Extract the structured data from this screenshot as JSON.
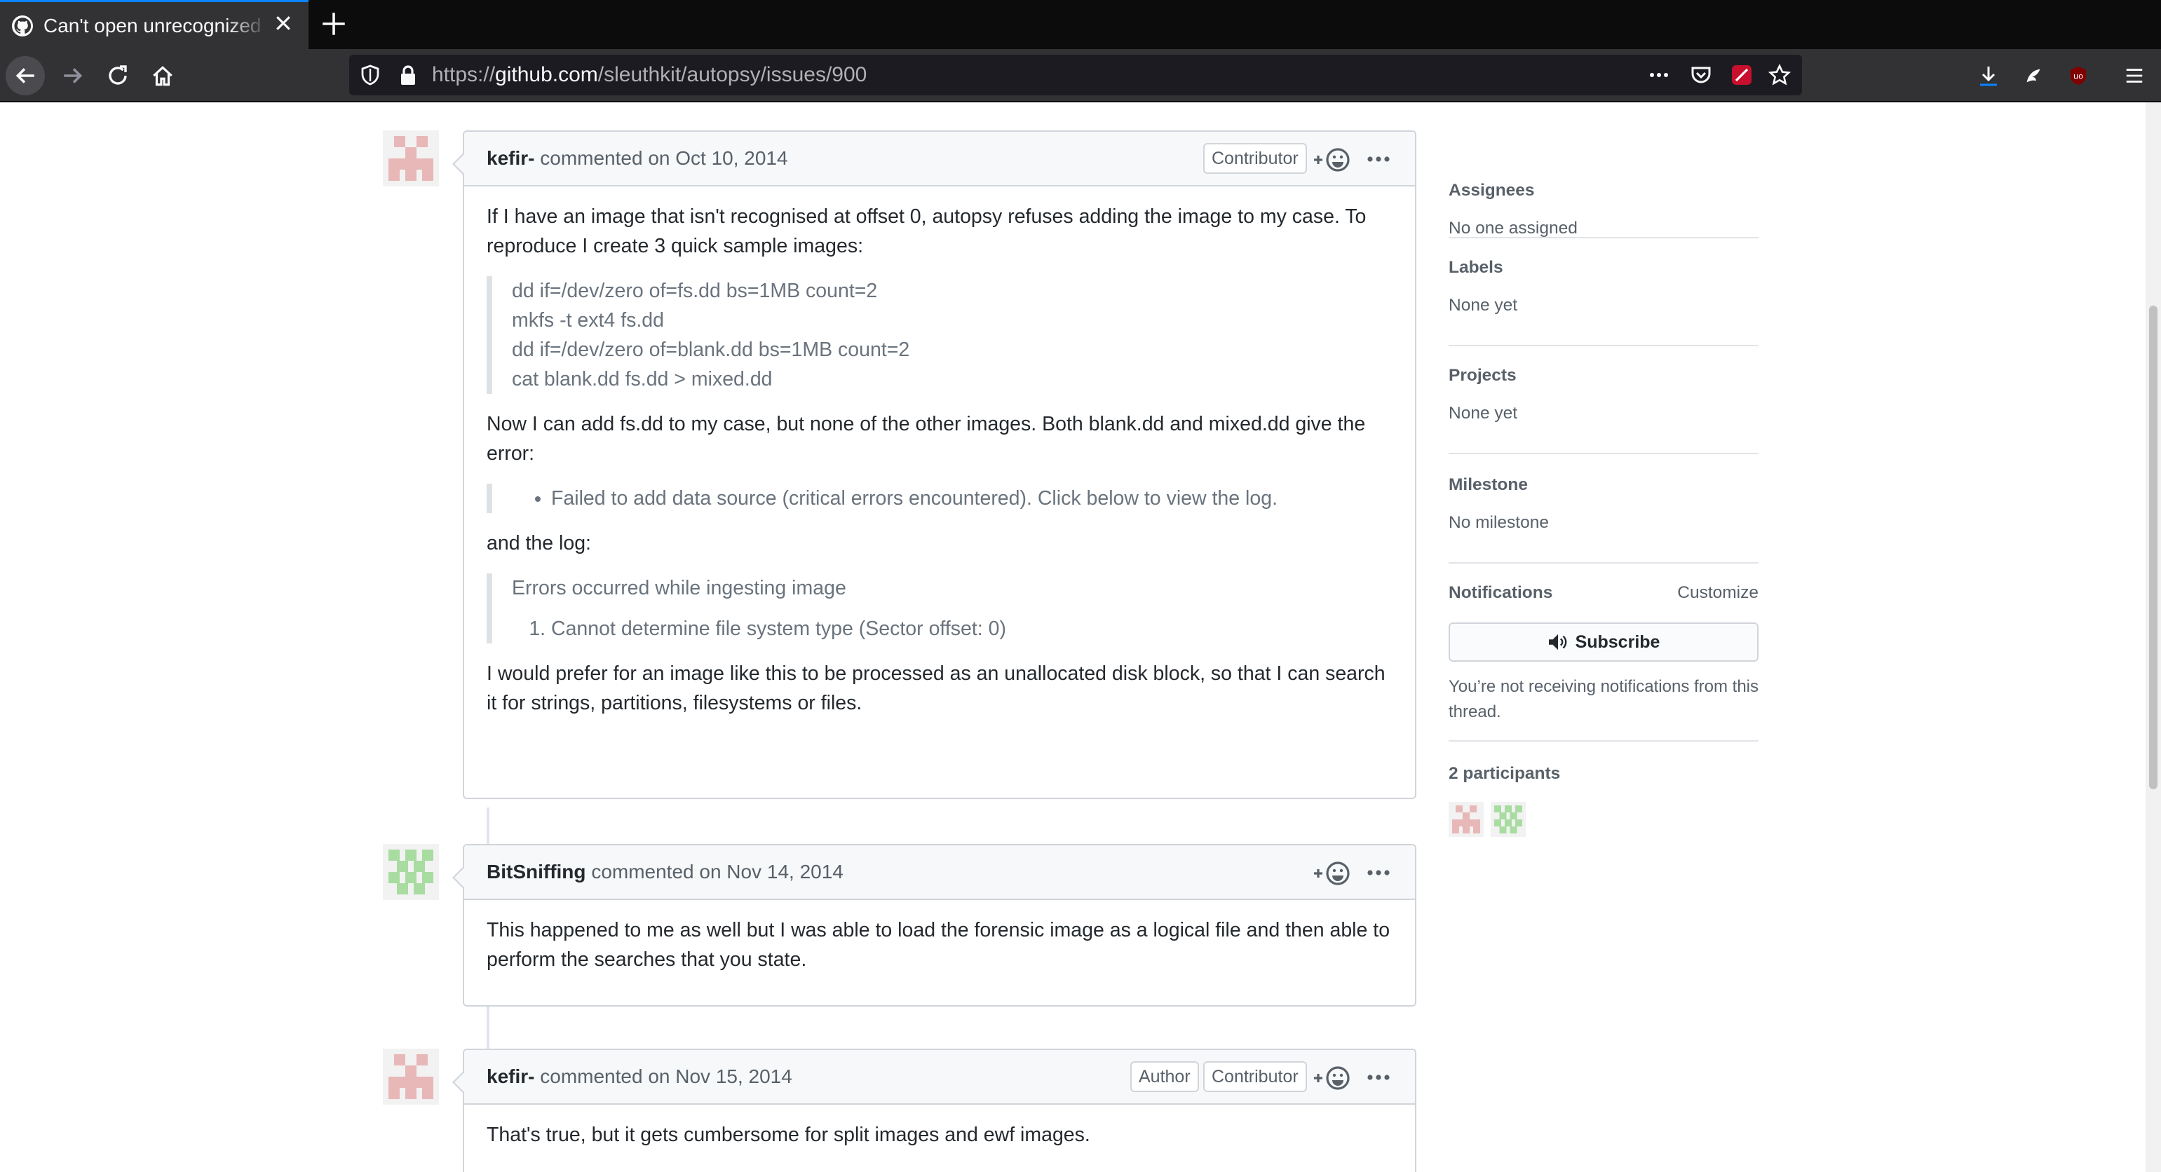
{
  "browser": {
    "tab_title": "Can't open unrecognized disk images",
    "url_prefix": "https://",
    "url_host": "github.com",
    "url_path": "/sleuthkit/autopsy/issues/900"
  },
  "comments": [
    {
      "author": "kefir-",
      "meta": "commented on Oct 10, 2014",
      "badges": [
        "Contributor"
      ],
      "p1": "If I have an image that isn't recognised at offset 0, autopsy refuses adding the image to my case. To reproduce I create 3 quick sample images:",
      "code": [
        "dd if=/dev/zero of=fs.dd bs=1MB count=2",
        "mkfs -t ext4 fs.dd",
        "dd if=/dev/zero of=blank.dd bs=1MB count=2",
        "cat blank.dd fs.dd > mixed.dd"
      ],
      "p2": "Now I can add fs.dd to my case, but none of the other images. Both blank.dd and mixed.dd give the error:",
      "error_item": "Failed to add data source (critical errors encountered). Click below to view the log.",
      "p3": "and the log:",
      "log_title": "Errors occurred while ingesting image",
      "log_item": "Cannot determine file system type (Sector offset: 0)",
      "p4": "I would prefer for an image like this to be processed as an unallocated disk block, so that I can search it for strings, partitions, filesystems or files."
    },
    {
      "author": "BitSniffing",
      "meta": "commented on Nov 14, 2014",
      "badges": [],
      "p1": "This happened to me as well but I was able to load the forensic image as a logical file and then able to perform the searches that you state."
    },
    {
      "author": "kefir-",
      "meta": "commented on Nov 15, 2014",
      "badges": [
        "Author",
        "Contributor"
      ],
      "p1": "That's true, but it gets cumbersome for split images and ewf images."
    }
  ],
  "sidebar": {
    "assignees": {
      "label": "Assignees",
      "value": "No one assigned"
    },
    "labels": {
      "label": "Labels",
      "value": "None yet"
    },
    "projects": {
      "label": "Projects",
      "value": "None yet"
    },
    "milestone": {
      "label": "Milestone",
      "value": "No milestone"
    },
    "notifications": {
      "label": "Notifications",
      "customize": "Customize",
      "subscribe": "Subscribe",
      "note": "You’re not receiving notifications from this thread."
    },
    "participants": {
      "label": "2 participants"
    }
  },
  "colors": {
    "avatar_kefir": "#e8b7b7",
    "avatar_bitsniffing": "#a8dca0",
    "accent": "#0a84ff"
  }
}
